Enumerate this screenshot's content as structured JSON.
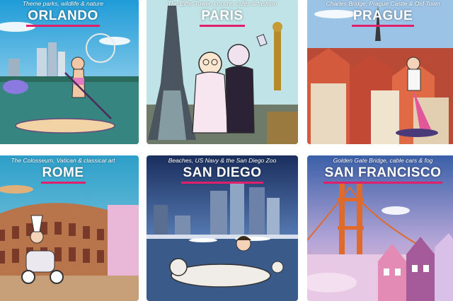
{
  "accent": "#e0206a",
  "cards": [
    {
      "title": "ORLANDO",
      "subtitle": "Theme parks, wildlife & nature"
    },
    {
      "title": "PARIS",
      "subtitle": "The Eiffel Tower, Louvre, cafés & fashion"
    },
    {
      "title": "PRAGUE",
      "subtitle": "Charles Bridge, Prague Castle & Old Town"
    },
    {
      "title": "ROME",
      "subtitle": "The Colosseum, Vatican & classical art"
    },
    {
      "title": "SAN DIEGO",
      "subtitle": "Beaches, US Navy & the San Diego Zoo"
    },
    {
      "title": "SAN FRANCISCO",
      "subtitle": "Golden Gate Bridge, cable cars & fog"
    }
  ]
}
